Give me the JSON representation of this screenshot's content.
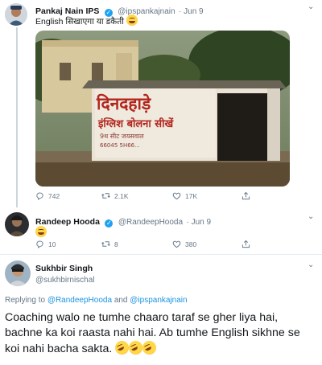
{
  "tweet1": {
    "name": "Pankaj Nain IPS",
    "handle": "@ipspankajnain",
    "date": "· Jun 9",
    "text": "English सिखाएगा या डकैती",
    "counts": {
      "replies": "742",
      "retweets": "2.1K",
      "likes": "17K"
    },
    "image": {
      "sign_line1": "दिनदहाड़े",
      "sign_line2": "इंग्लिश बोलना सीखें",
      "sign_line3": "9थ सीट जयसवाल",
      "sign_line4": "66045 5H66..."
    }
  },
  "tweet2": {
    "name": "Randeep Hooda",
    "handle": "@RandeepHooda",
    "date": "· Jun 9",
    "counts": {
      "replies": "10",
      "retweets": "8",
      "likes": "380"
    }
  },
  "tweet3": {
    "name": "Sukhbir Singh",
    "handle": "@sukhbirnischal",
    "replying_prefix": "Replying to",
    "replying_user1": "@RandeepHooda",
    "replying_and": "and",
    "replying_user2": "@ipspankajnain",
    "body": "Coaching walo ne tumhe chaaro taraf se gher liya hai, bachne ka koi raasta nahi hai. Ab tumhe English sikhne se koi nahi bacha sakta."
  },
  "icons": [
    "reply-icon",
    "retweet-icon",
    "like-icon",
    "share-icon",
    "verified-icon",
    "chevron-down-icon",
    "laughing-emoji"
  ],
  "colors": {
    "accent": "#1da1f2",
    "link": "#1b95e0",
    "secondary_text": "#657786",
    "divider": "#e6ecf0"
  }
}
